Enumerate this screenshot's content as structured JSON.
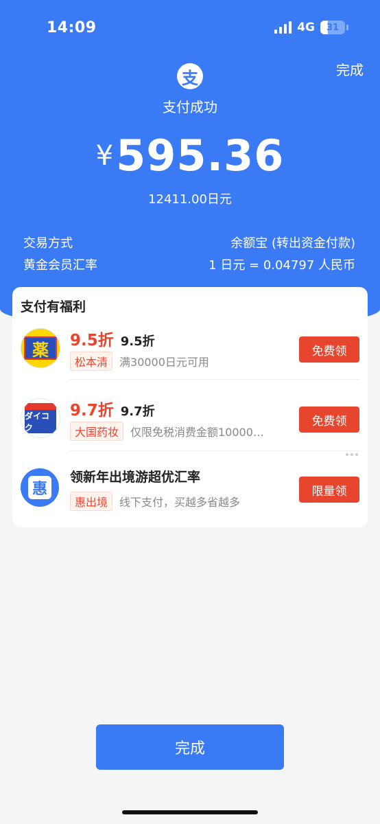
{
  "status_bar": {
    "time": "14:09",
    "network": "4G",
    "battery_percent": 31,
    "battery_label": "31"
  },
  "header": {
    "done_label": "完成",
    "pay_logo_glyph": "支",
    "status_text": "支付成功"
  },
  "payment": {
    "currency_symbol": "¥",
    "amount": "595.36",
    "foreign_amount": "12411.00日元",
    "rows": [
      {
        "label": "交易方式",
        "value": "余额宝 (转出资金付款)"
      },
      {
        "label": "黄金会员汇率",
        "value": "1 日元 = 0.04797 人民币"
      }
    ]
  },
  "benefits": {
    "title": "支付有福利",
    "offers": [
      {
        "logo_text": "薬",
        "discount": "9.5折",
        "subtitle": "9.5折",
        "merchant_tag": "松本清",
        "description": "满30000日元可用",
        "button_label": "免费领"
      },
      {
        "logo_text": "ダイコク",
        "discount": "9.7折",
        "subtitle": "9.7折",
        "merchant_tag": "大国药妆",
        "description": "仅限免税消费金额10000…",
        "button_label": "免费领"
      },
      {
        "logo_text": "惠",
        "title": "领新年出境游超优汇率",
        "merchant_tag": "惠出境",
        "description": "线下支付，买越多省越多",
        "button_label": "限量领"
      }
    ]
  },
  "footer": {
    "done_label": "完成"
  },
  "colors": {
    "primary_blue": "#3a7af5",
    "accent_red": "#e8452e",
    "background": "#f5f5f5"
  }
}
